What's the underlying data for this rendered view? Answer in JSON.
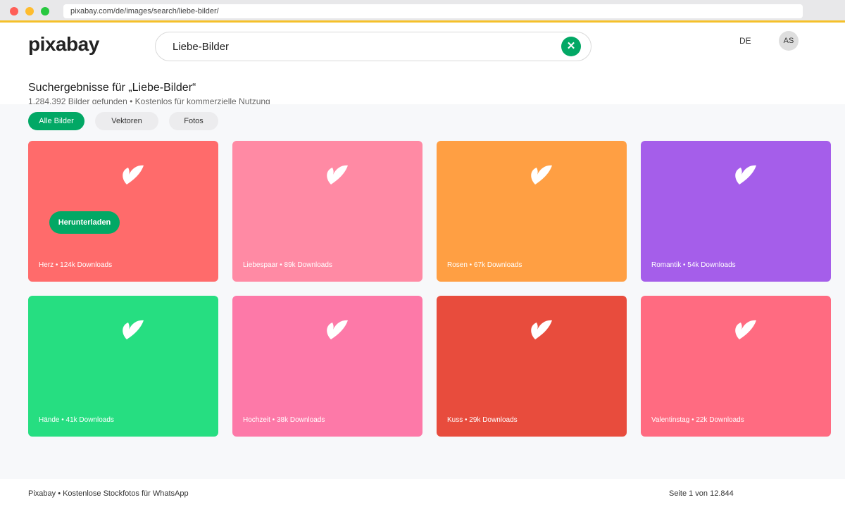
{
  "browser": {
    "url": "pixabay.com/de/images/search/liebe-bilder/"
  },
  "header": {
    "logo": "pixabay",
    "search_value": "Liebe-Bilder",
    "clear_symbol": "✕",
    "language": "DE",
    "avatar_initials": "AS"
  },
  "results": {
    "title": "Suchergebnisse für „Liebe-Bilder“",
    "subtitle": "1.284.392 Bilder gefunden • Kostenlos für kommerzielle Nutzung"
  },
  "filters": [
    {
      "label": "Alle Bilder",
      "active": true
    },
    {
      "label": "Vektoren",
      "active": false
    },
    {
      "label": "Fotos",
      "active": false
    }
  ],
  "cards": [
    {
      "caption": "Herz • 124k Downloads",
      "color": "#ff6b6b",
      "icon": "leaf-heart-icon",
      "hovered": true
    },
    {
      "caption": "Liebespaar • 89k Downloads",
      "color": "#ff8aa4",
      "icon": "leaf-heart-icon"
    },
    {
      "caption": "Rosen • 67k Downloads",
      "color": "#ff9f43",
      "icon": "leaf-heart-icon"
    },
    {
      "caption": "Romantik • 54k Downloads",
      "color": "#a55eea",
      "icon": "leaf-heart-icon"
    },
    {
      "caption": "Hände • 41k Downloads",
      "color": "#26de81",
      "icon": "leaf-heart-icon"
    },
    {
      "caption": "Hochzeit • 38k Downloads",
      "color": "#fd79a8",
      "icon": "leaf-heart-icon"
    },
    {
      "caption": "Kuss • 29k Downloads",
      "color": "#e84c3d",
      "icon": "leaf-heart-icon"
    },
    {
      "caption": "Valentinstag • 22k Downloads",
      "color": "#ff6b81",
      "icon": "leaf-heart-icon"
    }
  ],
  "download_label": "Herunterladen",
  "footer": {
    "left": "Pixabay • Kostenlose Stockfotos für WhatsApp",
    "right": "Seite 1 von 12.844"
  },
  "colors": {
    "accent": "#02a865",
    "top_border": "#f5c02a"
  }
}
